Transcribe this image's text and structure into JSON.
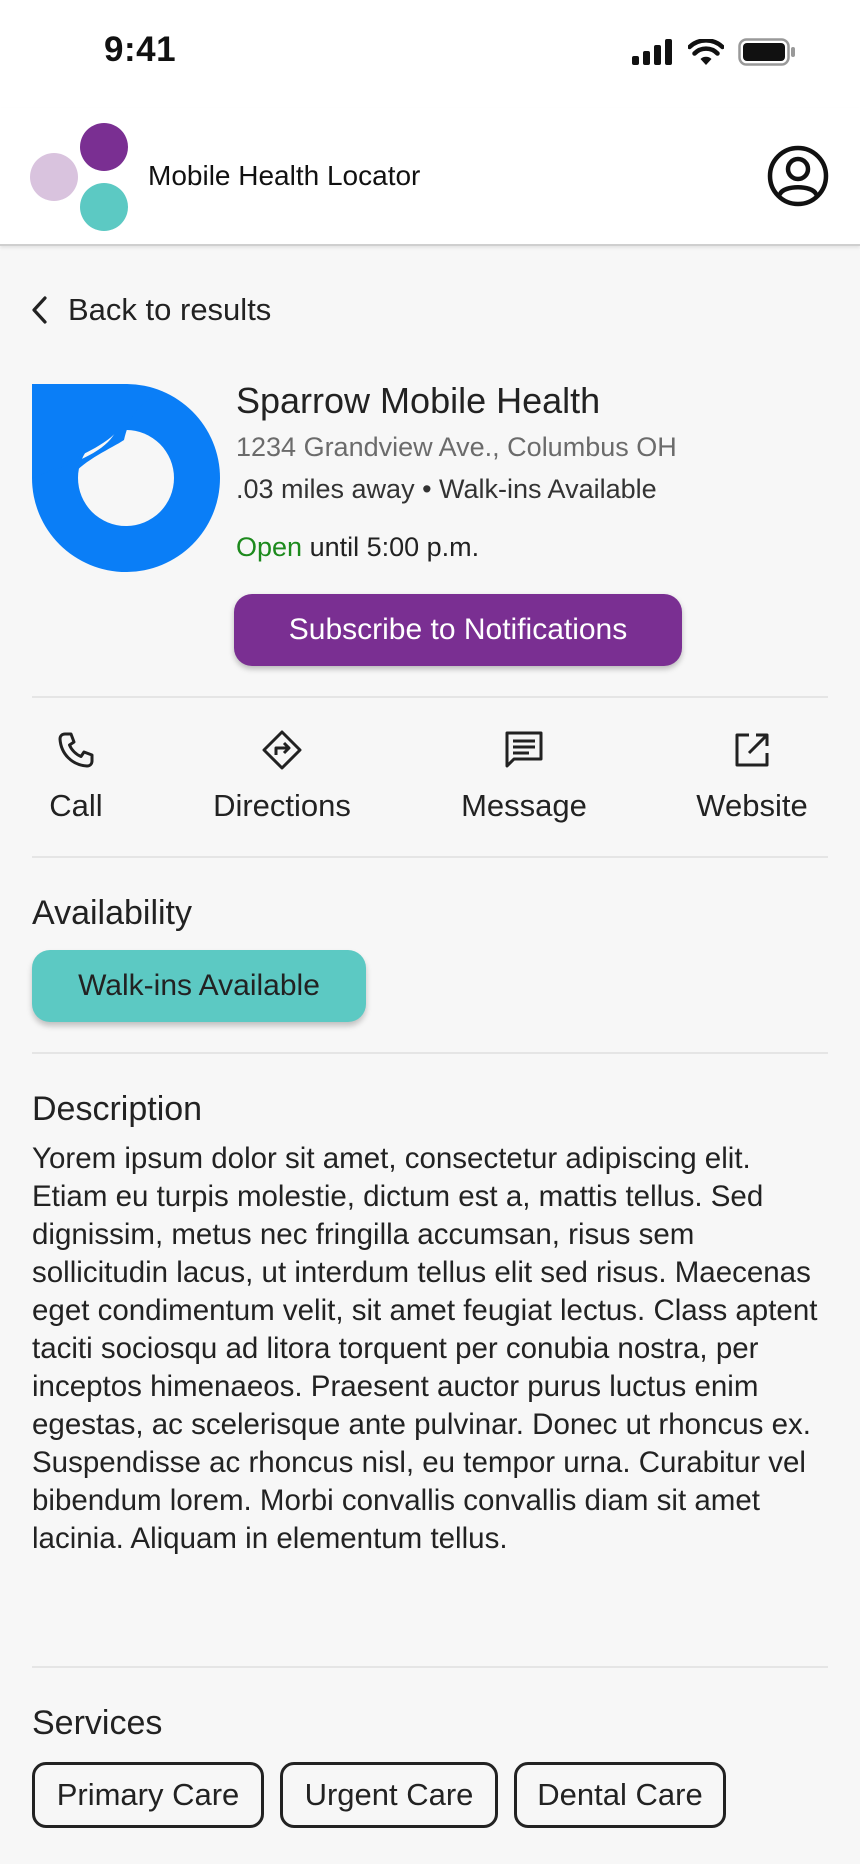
{
  "status_bar": {
    "time": "9:41",
    "icons": [
      "cellular-signal-icon",
      "wifi-icon",
      "battery-icon"
    ]
  },
  "header": {
    "app_title": "Mobile Health Locator",
    "logo_colors": [
      "#7a2f92",
      "#d9c3de",
      "#5cc9c3"
    ],
    "profile_icon": "user-circle-icon"
  },
  "navigation": {
    "back_label": "Back to results"
  },
  "provider": {
    "name": "Sparrow Mobile Health",
    "address": "1234 Grandview Ave., Columbus OH",
    "distance_and_walkins": ".03 miles away • Walk-ins Available",
    "open_status": "Open",
    "hours_text": "until 5:00 p.m.",
    "subscribe_label": "Subscribe to Notifications",
    "logo_color": "#0a7ef7"
  },
  "actions": [
    {
      "label": "Call",
      "icon": "phone-icon"
    },
    {
      "label": "Directions",
      "icon": "directions-icon"
    },
    {
      "label": "Message",
      "icon": "message-icon"
    },
    {
      "label": "Website",
      "icon": "external-link-icon"
    }
  ],
  "availability": {
    "title": "Availability",
    "pill": "Walk-ins Available"
  },
  "description": {
    "title": "Description",
    "text": "Yorem ipsum dolor sit amet, consectetur adipiscing elit. Etiam eu turpis molestie, dictum est a, mattis tellus. Sed dignissim, metus nec fringilla accumsan, risus sem sollicitudin lacus, ut interdum tellus elit sed risus. Maecenas eget condimentum velit, sit amet feugiat lectus. Class aptent taciti sociosqu ad litora torquent per conubia nostra, per inceptos himenaeos. Praesent auctor purus luctus enim egestas, ac scelerisque ante pulvinar. Donec ut rhoncus ex. Suspendisse ac rhoncus nisl, eu tempor urna. Curabitur vel bibendum lorem. Morbi convallis convallis diam sit amet lacinia. Aliquam in elementum tellus."
  },
  "services": {
    "title": "Services",
    "items": [
      "Primary Care",
      "Urgent Care",
      "Dental Care"
    ]
  },
  "colors": {
    "brand_purple": "#7a2f92",
    "teal": "#5cc9c3",
    "open_green": "#1d8a1d",
    "provider_blue": "#0a7ef7"
  }
}
